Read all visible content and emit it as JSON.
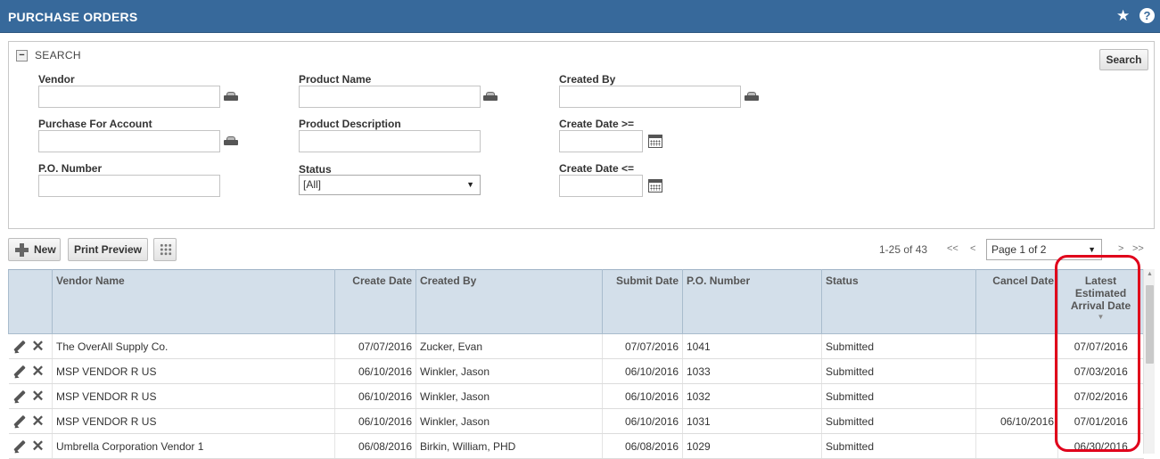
{
  "header": {
    "title": "PURCHASE ORDERS",
    "star_icon": "★",
    "help_icon": "?"
  },
  "search": {
    "collapse_symbol": "−",
    "title": "SEARCH",
    "button_label": "Search",
    "fields": {
      "vendor": {
        "label": "Vendor",
        "value": ""
      },
      "product_name": {
        "label": "Product Name",
        "value": ""
      },
      "created_by": {
        "label": "Created By",
        "value": ""
      },
      "purchase_for_account": {
        "label": "Purchase For Account",
        "value": ""
      },
      "product_description": {
        "label": "Product Description",
        "value": ""
      },
      "create_date_from": {
        "label": "Create Date >=",
        "value": ""
      },
      "po_number": {
        "label": "P.O. Number",
        "value": ""
      },
      "status": {
        "label": "Status",
        "value": "[All]"
      },
      "create_date_to": {
        "label": "Create Date <=",
        "value": ""
      }
    }
  },
  "toolbar": {
    "new_label": "New",
    "print_label": "Print Preview"
  },
  "pager": {
    "count": "1-25 of 43",
    "first": "<<",
    "prev": "<",
    "page_select": "Page 1 of 2",
    "next": ">",
    "last": ">>"
  },
  "grid": {
    "columns": {
      "vendor_name": "Vendor Name",
      "create_date": "Create Date",
      "created_by": "Created By",
      "submit_date": "Submit Date",
      "po_number": "P.O. Number",
      "status": "Status",
      "cancel_date": "Cancel Date",
      "arrival_date": "Latest Estimated Arrival Date"
    },
    "arrival_date_sorted": true,
    "rows": [
      {
        "vendor": "The OverAll Supply Co.",
        "create_date": "07/07/2016",
        "created_by": "Zucker, Evan",
        "submit_date": "07/07/2016",
        "po_number": "1041",
        "status": "Submitted",
        "cancel_date": "",
        "arrival_date": "07/07/2016"
      },
      {
        "vendor": "MSP VENDOR R US",
        "create_date": "06/10/2016",
        "created_by": "Winkler, Jason",
        "submit_date": "06/10/2016",
        "po_number": "1033",
        "status": "Submitted",
        "cancel_date": "",
        "arrival_date": "07/03/2016"
      },
      {
        "vendor": "MSP VENDOR R US",
        "create_date": "06/10/2016",
        "created_by": "Winkler, Jason",
        "submit_date": "06/10/2016",
        "po_number": "1032",
        "status": "Submitted",
        "cancel_date": "",
        "arrival_date": "07/02/2016"
      },
      {
        "vendor": "MSP VENDOR R US",
        "create_date": "06/10/2016",
        "created_by": "Winkler, Jason",
        "submit_date": "06/10/2016",
        "po_number": "1031",
        "status": "Submitted",
        "cancel_date": "06/10/2016",
        "arrival_date": "07/01/2016"
      },
      {
        "vendor": "Umbrella Corporation Vendor 1",
        "create_date": "06/08/2016",
        "created_by": "Birkin, William, PHD",
        "submit_date": "06/08/2016",
        "po_number": "1029",
        "status": "Submitted",
        "cancel_date": "",
        "arrival_date": "06/30/2016"
      }
    ]
  },
  "colors": {
    "header_bg": "#37699b",
    "grid_header_bg": "#d3dfea",
    "highlight": "#e0001b"
  },
  "icons": [
    "star-icon",
    "help-icon",
    "lookup-icon",
    "calendar-icon",
    "plus-icon",
    "column-grid-icon",
    "pencil-icon",
    "delete-x-icon",
    "chevron-down-icon"
  ]
}
